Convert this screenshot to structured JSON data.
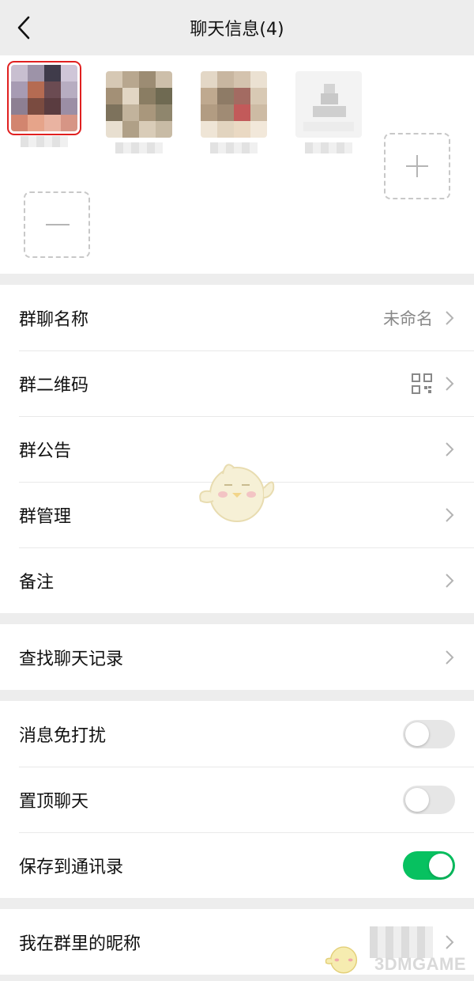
{
  "header": {
    "title": "聊天信息(4)"
  },
  "members": [
    {
      "avatar_colors": [
        "#b8aebf",
        "#8a6a75",
        "#d9c7cf",
        "#7c5e63",
        "#c47c6a"
      ],
      "selected": true
    },
    {
      "avatar_colors": [
        "#c9b9a8",
        "#8b7d64",
        "#a89680",
        "#6f6a55",
        "#ddd2c2"
      ],
      "selected": false
    },
    {
      "avatar_colors": [
        "#d8ccbd",
        "#9a8774",
        "#c3ad97",
        "#b75c5c",
        "#e8dcc9"
      ],
      "selected": false
    },
    {
      "avatar_colors": [
        "#efefef",
        "#d0d0d0",
        "#c4c4c4",
        "#e6e6e6",
        "#f6f6f6"
      ],
      "selected": false
    }
  ],
  "add_member_icon": "plus-icon",
  "remove_member_icon": "minus-icon",
  "sections": {
    "group1": {
      "name_label": "群聊名称",
      "name_value": "未命名",
      "qr_label": "群二维码",
      "notice_label": "群公告",
      "manage_label": "群管理",
      "remark_label": "备注"
    },
    "group2": {
      "search_label": "查找聊天记录"
    },
    "group3": {
      "mute_label": "消息免打扰",
      "mute_on": false,
      "top_label": "置顶聊天",
      "top_on": false,
      "save_label": "保存到通讯录",
      "save_on": true
    },
    "group4": {
      "nickname_label": "我在群里的昵称"
    }
  },
  "colors": {
    "toggle_on": "#07c160",
    "toggle_off": "#e6e6e6",
    "selection": "#e02020"
  },
  "watermark": "3DMGAME"
}
